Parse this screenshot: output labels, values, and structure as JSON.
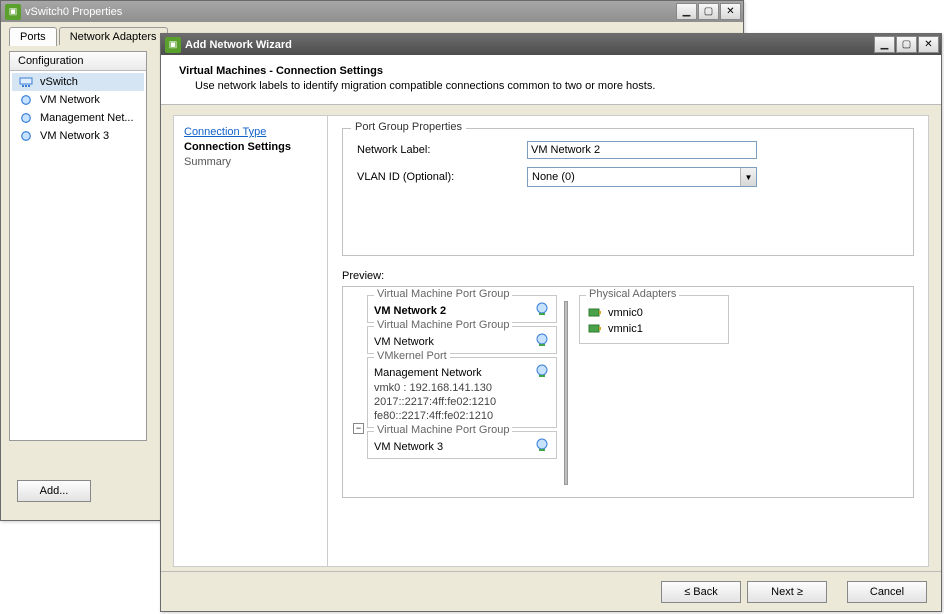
{
  "propsWindow": {
    "title": "vSwitch0 Properties",
    "tabs": {
      "ports": "Ports",
      "adapters": "Network Adapters"
    },
    "configHeader": "Configuration",
    "items": [
      {
        "label": "vSwitch"
      },
      {
        "label": "VM Network"
      },
      {
        "label": "Management Net..."
      },
      {
        "label": "VM Network 3"
      }
    ],
    "addBtn": "Add..."
  },
  "wizard": {
    "title": "Add Network Wizard",
    "header": {
      "title": "Virtual Machines - Connection Settings",
      "desc": "Use network labels to identify migration compatible connections common to two or more hosts."
    },
    "steps": {
      "connType": "Connection Type",
      "connSettings": "Connection Settings",
      "summary": "Summary"
    },
    "portGroup": {
      "legend": "Port Group Properties",
      "labelNet": "Network Label:",
      "labelVlan": "VLAN ID (Optional):",
      "netVal": "VM Network 2",
      "vlanVal": "None (0)"
    },
    "previewLabel": "Preview:",
    "preview": {
      "vmPgLegend": "Virtual Machine Port Group",
      "vmkLegend": "VMkernel Port",
      "paLegend": "Physical Adapters",
      "pg1": "VM Network 2",
      "pg2": "VM Network",
      "mgmt": "Management Network",
      "vmk0": "vmk0 : 192.168.141.130",
      "ip6a": "2017::2217:4ff:fe02:1210",
      "ip6b": "fe80::2217:4ff:fe02:1210",
      "pg4": "VM Network 3",
      "nic0": "vmnic0",
      "nic1": "vmnic1"
    },
    "buttons": {
      "back": "≤ Back",
      "next": "Next ≥",
      "cancel": "Cancel"
    }
  }
}
